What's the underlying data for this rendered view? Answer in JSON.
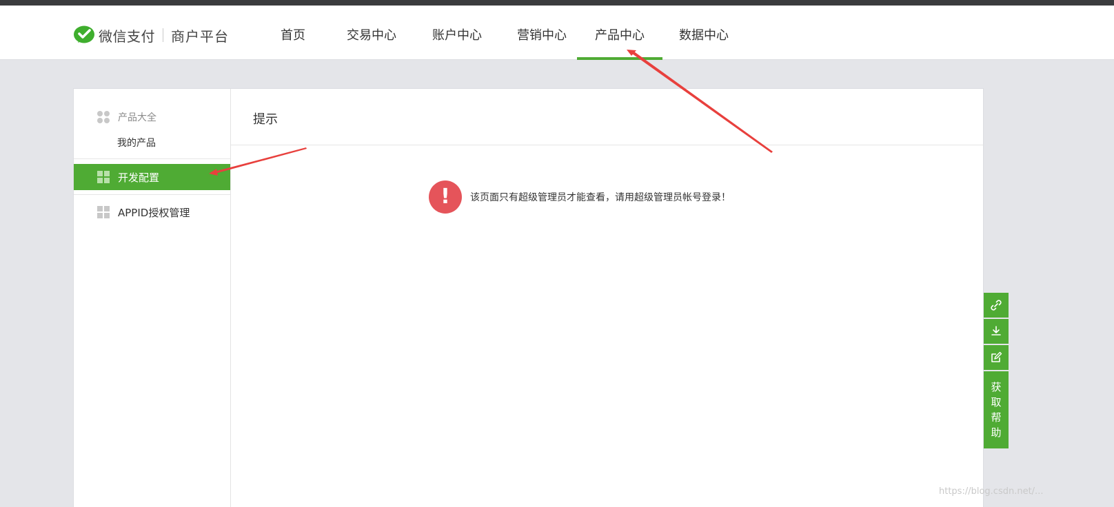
{
  "header": {
    "logo_pay": "微信支付",
    "logo_platform": "商户平台",
    "nav": [
      {
        "label": "首页"
      },
      {
        "label": "交易中心"
      },
      {
        "label": "账户中心"
      },
      {
        "label": "营销中心"
      },
      {
        "label": "产品中心",
        "active": true
      },
      {
        "label": "数据中心"
      }
    ]
  },
  "sidebar": {
    "group_title": "产品大全",
    "sub_item": "我的产品",
    "items": [
      {
        "label": "开发配置",
        "active": true
      },
      {
        "label": "APPID授权管理"
      }
    ]
  },
  "content": {
    "title": "提示",
    "alert_symbol": "!",
    "alert_text": "该页面只有超级管理员才能查看，请用超级管理员帐号登录！"
  },
  "float_toolbar": {
    "help": [
      "获",
      "取",
      "帮",
      "助"
    ]
  },
  "watermark": "https://blog.csdn.net/...",
  "colors": {
    "accent": "#4fab34",
    "alert": "#e5545a",
    "annotation": "#e8403d",
    "page_bg": "#e4e5e9"
  }
}
